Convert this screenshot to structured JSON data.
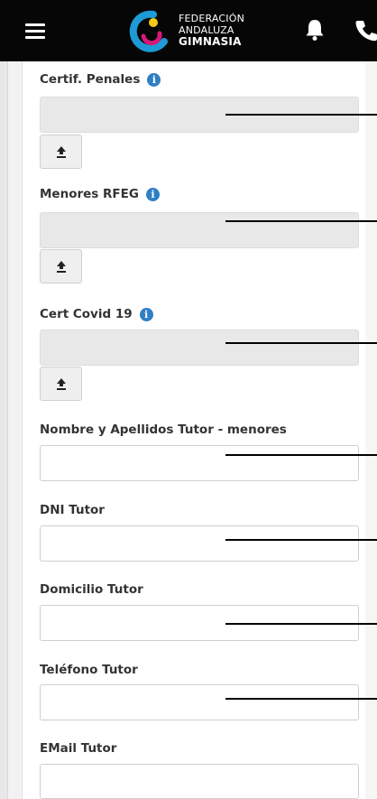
{
  "header": {
    "brand_line1": "FEDERACIÓN",
    "brand_line2": "ANDALUZA",
    "brand_line3": "GIMNASIA",
    "icons": [
      "menu-icon",
      "logo",
      "bell-icon",
      "phone-icon"
    ],
    "background": "#060606"
  },
  "form": {
    "cert_penales_label": "Certif. Penales",
    "menores_rfeg_label": "Menores RFEG",
    "cert_covid_label": "Cert Covid 19",
    "nombre_tutor_label": "Nombre y Apellidos Tutor - menores",
    "dni_tutor_label": "DNI Tutor",
    "domicilio_tutor_label": "Domicilio Tutor",
    "telefono_tutor_label": "Teléfono Tutor",
    "email_tutor_label": "EMail Tutor",
    "info_glyph": "i",
    "nombre_tutor_value": "",
    "dni_tutor_value": "",
    "domicilio_tutor_value": "",
    "telefono_tutor_value": "",
    "email_tutor_value": ""
  },
  "colors": {
    "info_blue": "#2f7fc3",
    "logo_blue": "#1e9ad6",
    "logo_magenta": "#d6197a",
    "logo_yellow": "#f2c81a"
  }
}
